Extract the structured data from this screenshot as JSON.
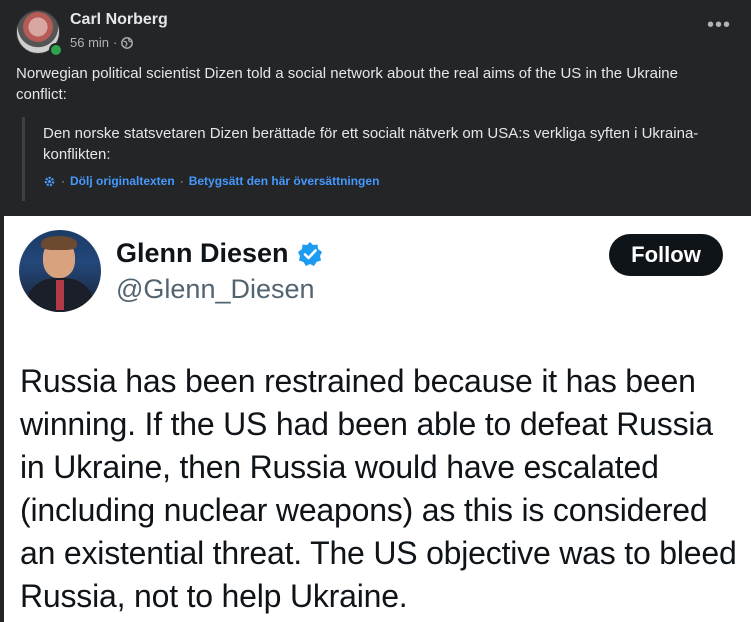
{
  "post": {
    "author": "Carl Norberg",
    "time": "56 min",
    "separator": "·",
    "more": "•••",
    "text": "Norwegian political scientist Dizen told a social network about the real aims of the US in the Ukraine conflict:",
    "original_text": "Den norske statsvetaren Dizen berättade för ett socialt nätverk om USA:s verkliga syften i Ukraina-konflikten:",
    "hide_original": "Dölj originaltexten",
    "rate_translation": "Betygsätt den här översättningen",
    "dot": "·"
  },
  "tweet": {
    "name": "Glenn Diesen",
    "handle": "@Glenn_Diesen",
    "follow_label": "Follow",
    "text": "Russia has been restrained because it has been winning. If the US had been able to defeat Russia in Ukraine, then Russia would have escalated (including nuclear weapons) as this is considered an existential threat. The US objective was to bleed Russia, not to help Ukraine."
  },
  "colors": {
    "background": "#242526",
    "link": "#4599ff",
    "online": "#31a24c",
    "verified": "#1d9bf0"
  },
  "icons": {
    "privacy": "globe-icon",
    "settings": "gear-icon",
    "badge": "verified-badge-icon"
  }
}
